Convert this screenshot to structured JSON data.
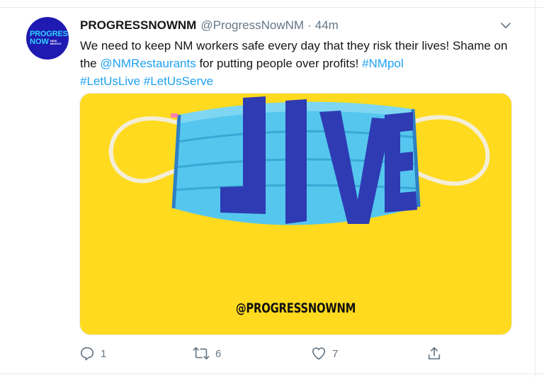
{
  "tweet": {
    "avatar_line1": "PROGRESS",
    "avatar_line2": "NOW",
    "avatar_line3": "NEW MEXICO",
    "display_name": "PROGRESSNOWNM",
    "handle": "@ProgressNowNM",
    "separator": "·",
    "time": "44m",
    "text_part1": "We need to keep NM workers safe every day that they risk their lives! Shame on the ",
    "mention": "@NMRestaurants",
    "text_part2": " for putting people over profits! ",
    "hashtag1": "#NMpol",
    "hashtag2": "#LetUsLive",
    "hashtag3": "#LetUsServe",
    "media": {
      "mask_text": "LIVE",
      "watermark": "@PROGRESSNOWNM",
      "background_color": "#ffda1e",
      "mask_color": "#55c7ee"
    },
    "actions": {
      "reply_count": "1",
      "retweet_count": "6",
      "like_count": "7"
    }
  },
  "colors": {
    "link": "#1da1f2",
    "muted": "#657786",
    "text": "#14171a"
  }
}
